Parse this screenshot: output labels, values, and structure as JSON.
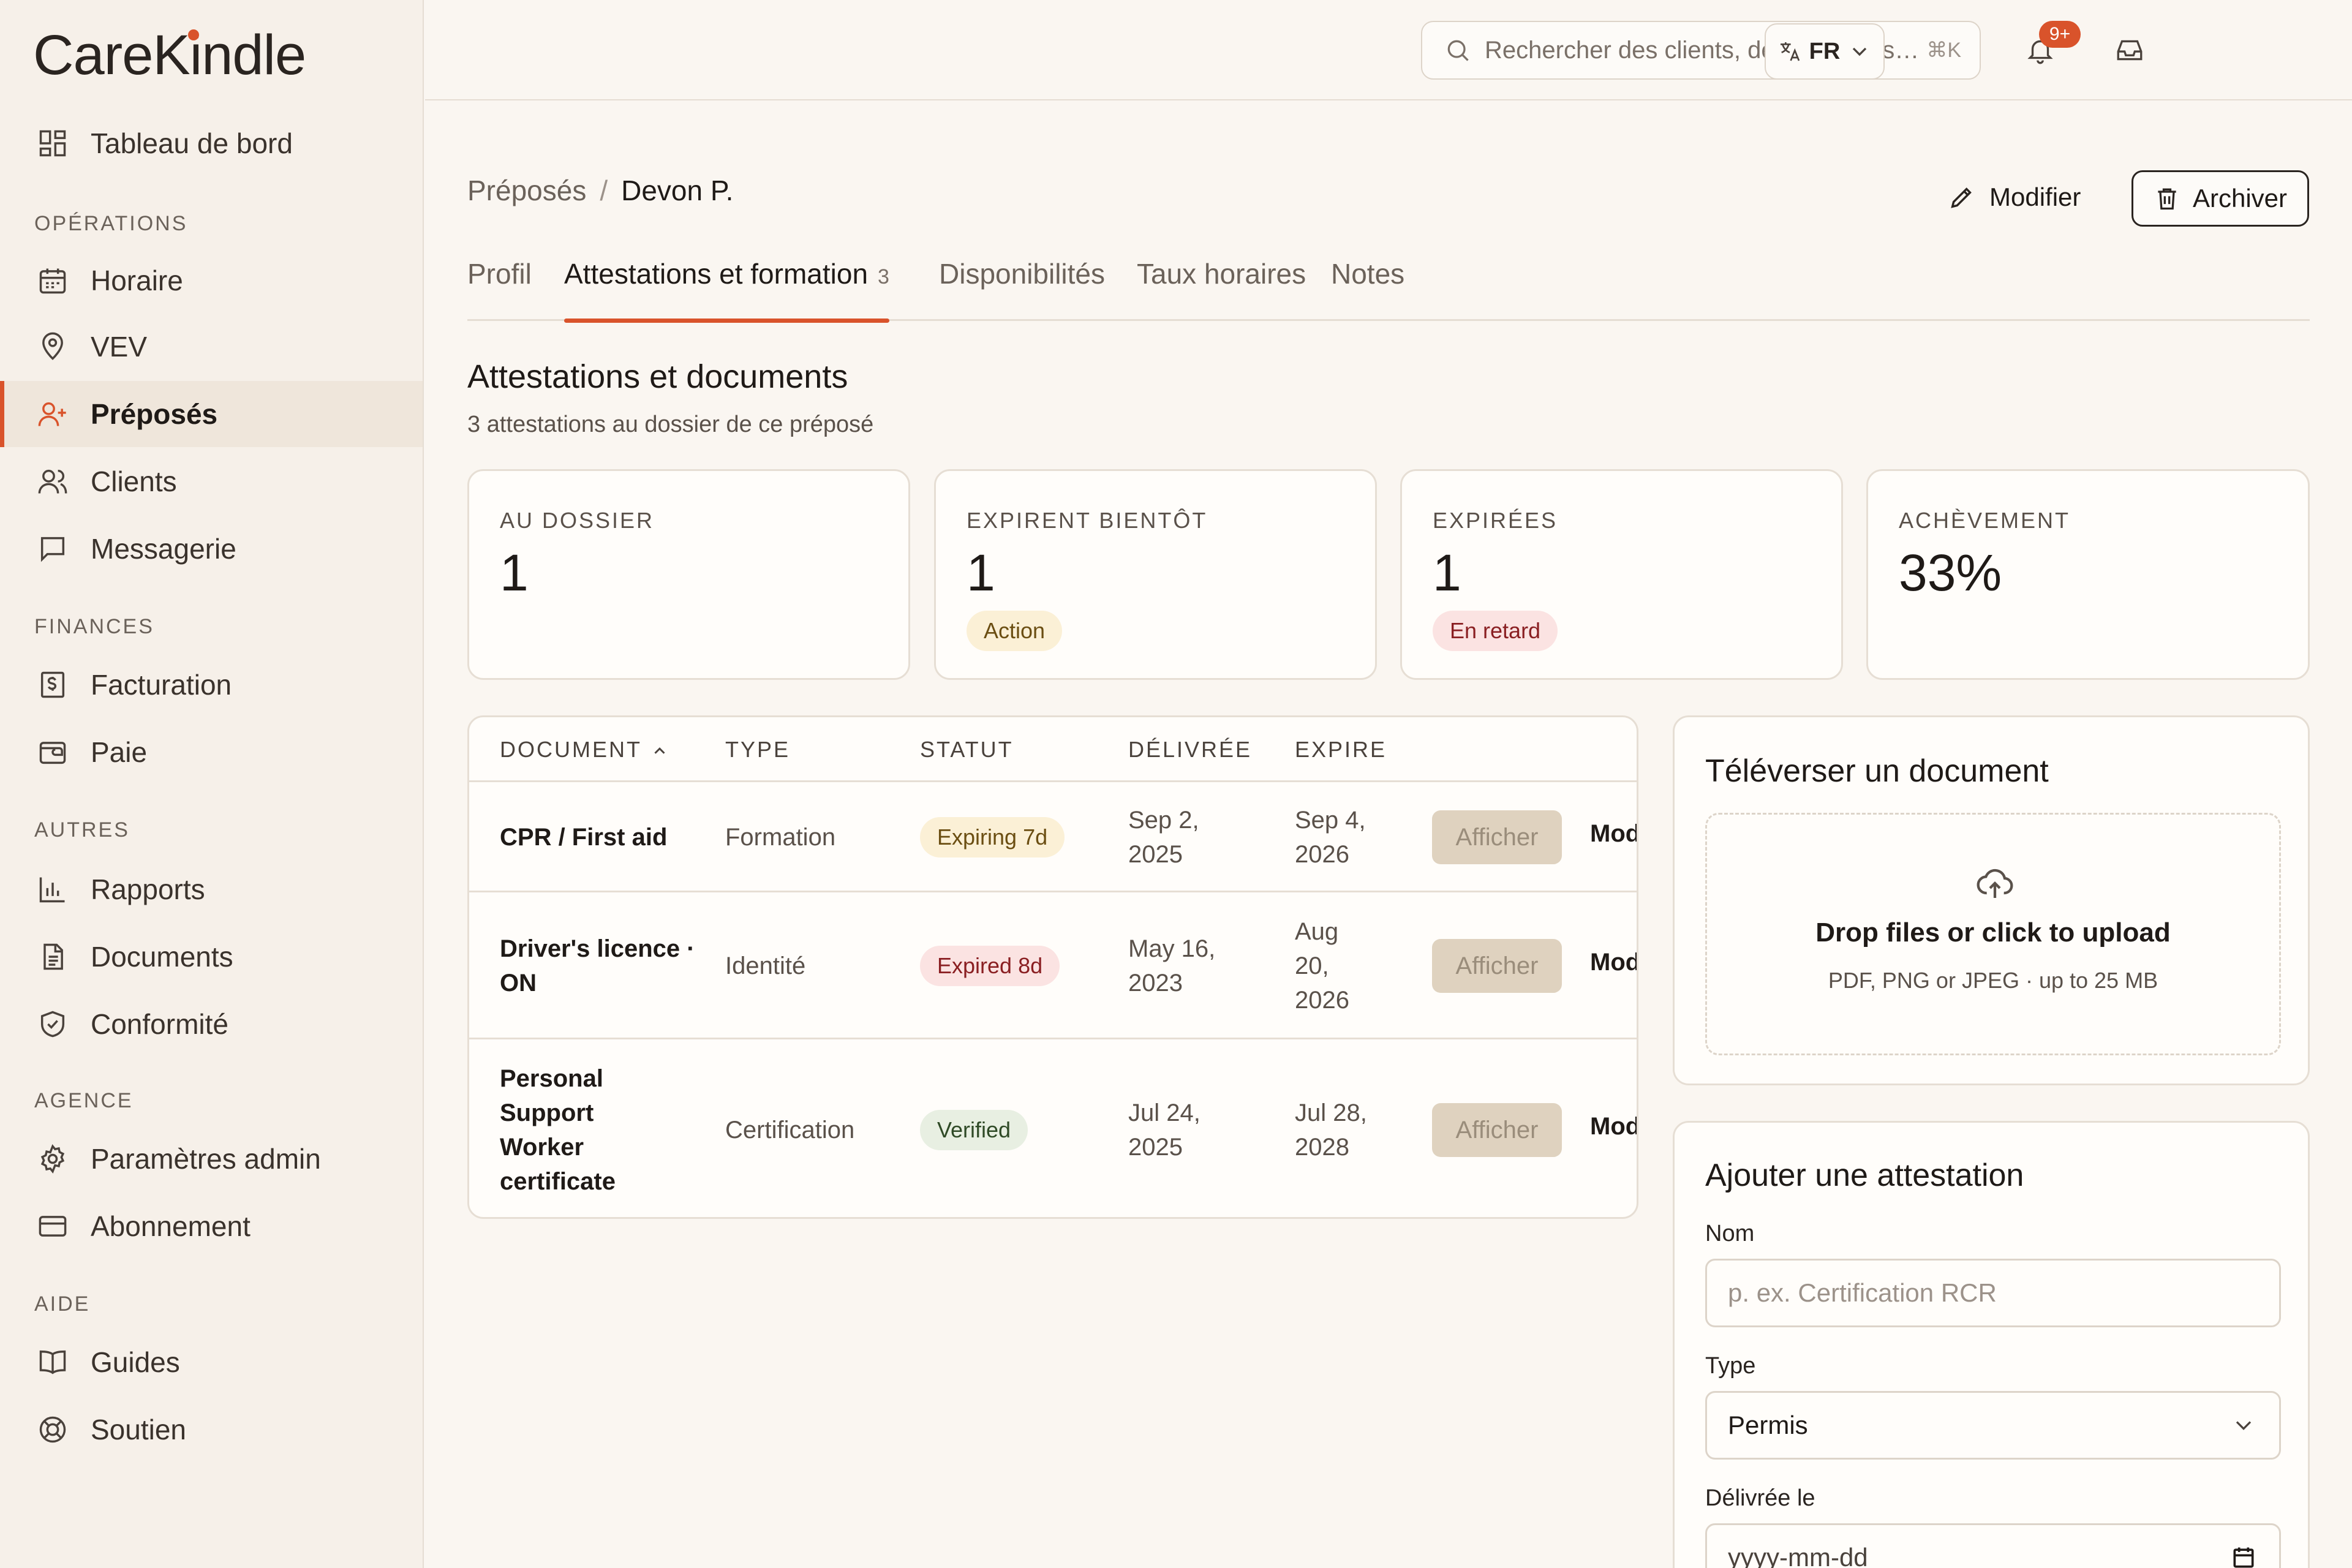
{
  "app": {
    "name": "CareKindle"
  },
  "sidebar": {
    "items": [
      {
        "label": "Tableau de bord",
        "icon": "dashboard-icon"
      },
      {
        "label": "Horaire",
        "icon": "calendar-icon"
      },
      {
        "label": "VEV",
        "icon": "map-pin-icon"
      },
      {
        "label": "Préposés",
        "icon": "user-plus-icon",
        "active": true
      },
      {
        "label": "Clients",
        "icon": "users-icon"
      },
      {
        "label": "Messagerie",
        "icon": "message-icon"
      },
      {
        "label": "Facturation",
        "icon": "invoice-icon"
      },
      {
        "label": "Paie",
        "icon": "wallet-icon"
      },
      {
        "label": "Rapports",
        "icon": "bar-chart-icon"
      },
      {
        "label": "Documents",
        "icon": "document-icon"
      },
      {
        "label": "Conformité",
        "icon": "shield-check-icon"
      },
      {
        "label": "Paramètres admin",
        "icon": "gear-icon"
      },
      {
        "label": "Abonnement",
        "icon": "credit-card-icon"
      },
      {
        "label": "Guides",
        "icon": "book-icon"
      },
      {
        "label": "Soutien",
        "icon": "lifebuoy-icon"
      }
    ],
    "sections": {
      "operations": "OPÉRATIONS",
      "finances": "FINANCES",
      "autres": "AUTRES",
      "agence": "AGENCE",
      "aide": "AIDE"
    }
  },
  "topbar": {
    "search_placeholder": "Rechercher des clients, des préposés…",
    "search_shortcut": "⌘K",
    "notifications_count": "9+",
    "language": "FR"
  },
  "breadcrumb": {
    "parent": "Préposés",
    "separator": "/",
    "current": "Devon P."
  },
  "actions": {
    "edit": "Modifier",
    "archive": "Archiver"
  },
  "tabs": [
    {
      "label": "Profil"
    },
    {
      "label": "Attestations et formation",
      "count": "3",
      "active": true
    },
    {
      "label": "Disponibilités"
    },
    {
      "label": "Taux horaires"
    },
    {
      "label": "Notes"
    }
  ],
  "section": {
    "title": "Attestations et documents",
    "subtitle": "3 attestations au dossier de ce préposé"
  },
  "stats": [
    {
      "label": "AU DOSSIER",
      "value": "1"
    },
    {
      "label": "EXPIRENT BIENTÔT",
      "value": "1",
      "pill": "Action"
    },
    {
      "label": "EXPIRÉES",
      "value": "1",
      "pill": "En retard"
    },
    {
      "label": "ACHÈVEMENT",
      "value": "33%"
    }
  ],
  "table": {
    "columns": {
      "document": "DOCUMENT",
      "type": "TYPE",
      "status": "STATUT",
      "issued": "DÉLIVRÉE",
      "expires": "EXPIRE"
    },
    "rows": [
      {
        "document": "CPR / First aid",
        "type": "Formation",
        "status": "Expiring 7d",
        "issued": "Sep 2, 2025",
        "expires": "Sep 4, 2026",
        "view": "Afficher",
        "modify": "Modifier"
      },
      {
        "document": "Driver's licence · ON",
        "type": "Identité",
        "status": "Expired 8d",
        "issued": "May 16, 2023",
        "expires": "Aug 20, 2026",
        "view": "Afficher",
        "modify": "Modifier"
      },
      {
        "document": "Personal Support Worker certificate",
        "type": "Certification",
        "status": "Verified",
        "issued": "Jul 24, 2025",
        "expires": "Jul 28, 2028",
        "view": "Afficher",
        "modify": "Modifier"
      }
    ]
  },
  "upload": {
    "title": "Téléverser un document",
    "drop_title": "Drop files or click to upload",
    "drop_sub": "PDF, PNG or JPEG · up to 25 MB"
  },
  "form": {
    "title": "Ajouter une attestation",
    "name_label": "Nom",
    "name_placeholder": "p. ex. Certification RCR",
    "type_label": "Type",
    "type_value": "Permis",
    "issued_label": "Délivrée le",
    "issued_placeholder": "yyyy-mm-dd"
  },
  "colors": {
    "accent": "#d9532b",
    "background": "#faf6f1",
    "sidebar": "#f6f0e9"
  }
}
